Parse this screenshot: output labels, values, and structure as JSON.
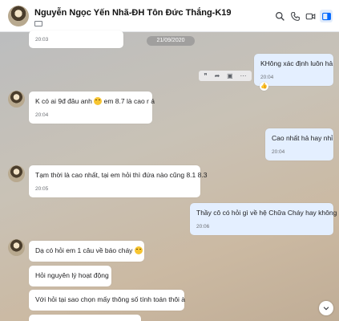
{
  "header": {
    "title": "Nguyễn Ngọc Yến Nhã-ĐH Tôn Đức Thắng-K19",
    "icons": [
      "search-icon",
      "phone-icon",
      "video-icon",
      "sidebar-toggle-icon"
    ]
  },
  "date_separator": "21/09/2020",
  "top_partial": {
    "time": "20:03"
  },
  "messages": [
    {
      "side": "me",
      "text": "KHông xác định luôn hả",
      "time": "20:04"
    },
    {
      "side": "other",
      "text_before": "K có ai 9đ đâu anh",
      "text_after": "em 8.7 là cao r á",
      "time": "20:04"
    },
    {
      "side": "me",
      "text": "Cao nhất hả hay nhỉ",
      "time": "20:04"
    },
    {
      "side": "other",
      "text": "Tạm thời là cao nhất, tại em hỏi thì đứa nào cũng 8.1 8.3",
      "time": "20:05"
    },
    {
      "side": "me",
      "text": "Thầy cô có hỏi gì về hệ Chữa Cháy hay không",
      "time": "20:06"
    },
    {
      "side": "other",
      "text": "Dạ có hỏi em 1 câu về báo cháy"
    },
    {
      "side": "other",
      "text": "Hỏi nguyên lý hoạt động"
    },
    {
      "side": "other",
      "text": "Với hỏi tại sao chọn mấy thông số tính toán thôi à"
    }
  ],
  "colors": {
    "accent": "#0068ff",
    "my_bubble": "#e4efff",
    "their_bubble": "#ffffff"
  }
}
